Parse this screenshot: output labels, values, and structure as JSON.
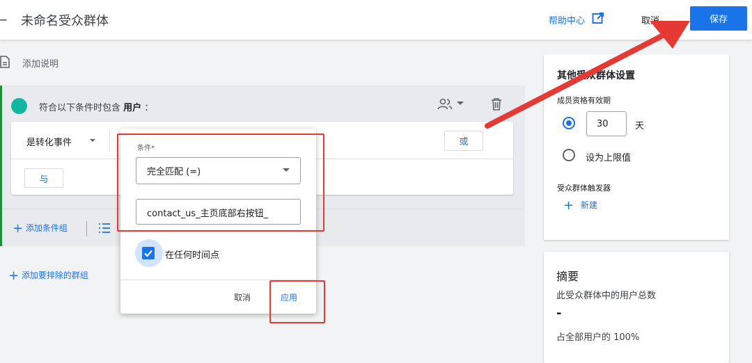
{
  "header": {
    "back_icon": "arrow-back-icon",
    "title": "未命名受众群体",
    "help_label": "帮助中心",
    "cancel_label": "取消",
    "save_label": "保存"
  },
  "editor": {
    "add_description": "添加说明",
    "condition_prefix": "符合以下条件时包含",
    "condition_subject": "用户",
    "condition_suffix": "：",
    "event_select": "是转化事件",
    "or_label": "或",
    "and_label": "与",
    "add_condition_group": "添加条件组",
    "add_exclude_group": "添加要排除的群组"
  },
  "popover": {
    "condition_label": "条件*",
    "match_type": "完全匹配 (=)",
    "value": "contact_us_主页底部右按钮_",
    "any_time_label": "在任何时间点",
    "any_time_checked": true,
    "cancel_label": "取消",
    "apply_label": "应用"
  },
  "settings": {
    "title": "其他受众群体设置",
    "membership_label": "成员资格有效期",
    "days_value": "30",
    "days_unit": "天",
    "max_limit_label": "设为上限值",
    "trigger_label": "受众群体触发器",
    "new_trigger_label": "新建"
  },
  "summary": {
    "title": "摘要",
    "subtitle": "此受众群体中的用户总数",
    "value": "-",
    "percent_text": "占全部用户的 100%"
  },
  "colors": {
    "primary": "#1a73e8",
    "teal_dot": "#12b5a0",
    "annotation_red": "#e53935"
  }
}
